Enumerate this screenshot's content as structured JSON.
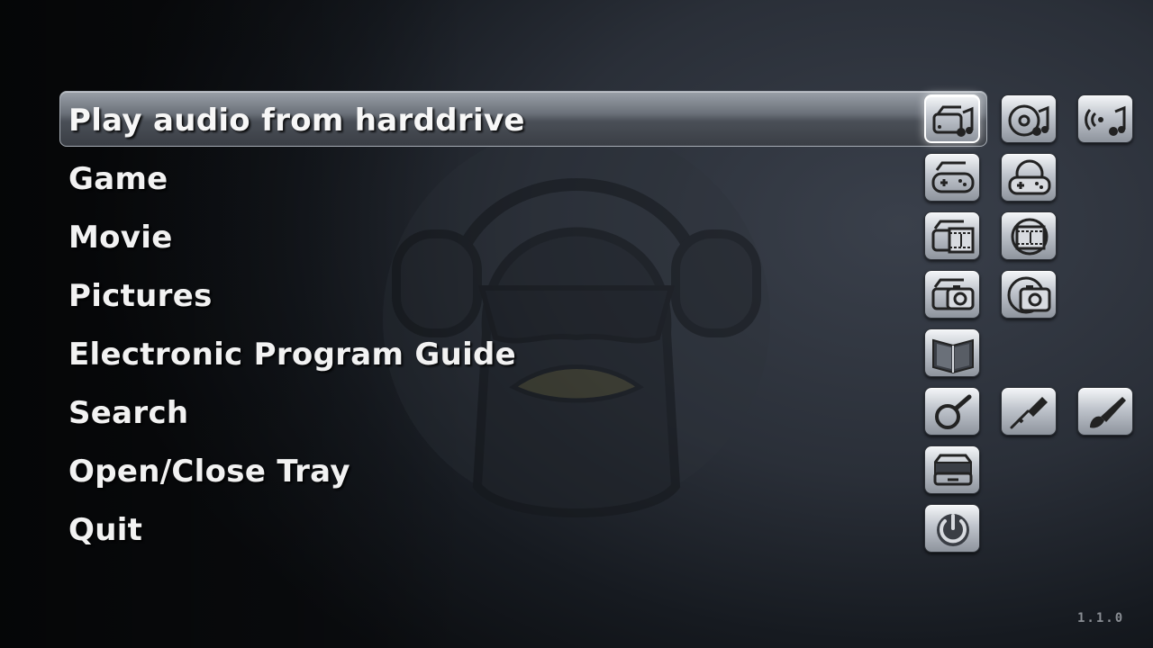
{
  "menu": {
    "items": [
      {
        "label": "Play audio from harddrive",
        "selected": true,
        "icons": [
          "harddrive-audio-icon",
          "cd-audio-icon",
          "radio-stream-icon"
        ]
      },
      {
        "label": "Game",
        "icons": [
          "harddrive-game-icon",
          "disc-game-icon"
        ]
      },
      {
        "label": "Movie",
        "icons": [
          "harddrive-movie-icon",
          "disc-movie-icon"
        ]
      },
      {
        "label": "Pictures",
        "icons": [
          "harddrive-pictures-icon",
          "disc-pictures-icon"
        ]
      },
      {
        "label": "Electronic Program Guide",
        "icons": [
          "program-guide-book-icon"
        ]
      },
      {
        "label": "Search",
        "icons": [
          "magnifier-icon",
          "screwdriver-icon",
          "paintbrush-icon"
        ]
      },
      {
        "label": "Open/Close Tray",
        "icons": [
          "tray-eject-icon"
        ]
      },
      {
        "label": "Quit",
        "icons": [
          "power-icon"
        ]
      }
    ]
  },
  "version": "1.1.0",
  "colors": {
    "background": "#1c2028",
    "text": "#f2f2f2",
    "selection_bar": "#6b717a",
    "version_text": "#8a8e94"
  }
}
